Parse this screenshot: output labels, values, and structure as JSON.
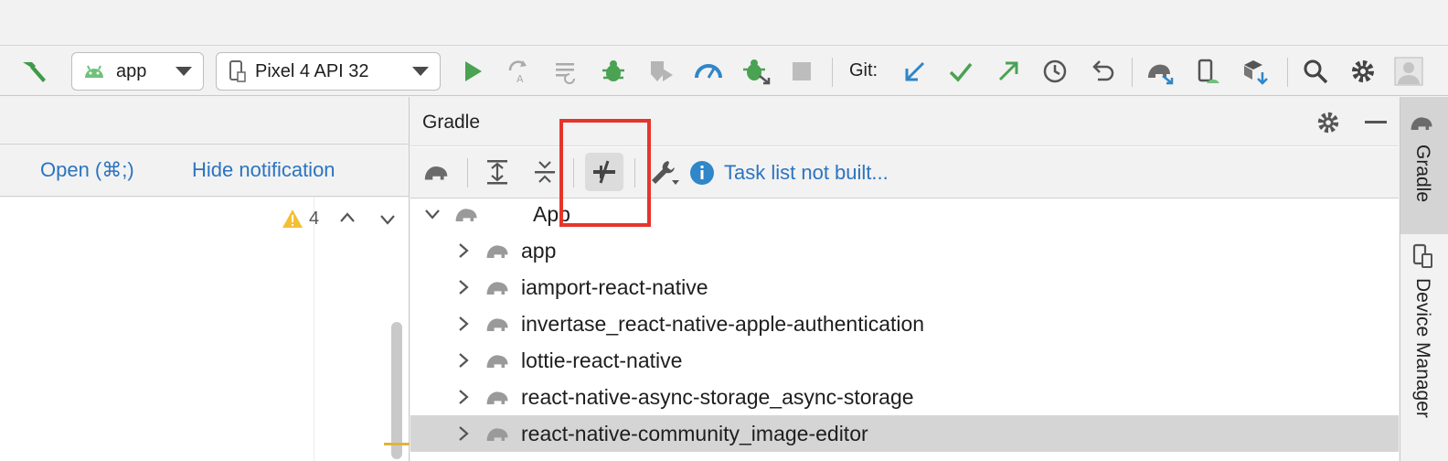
{
  "toolbar": {
    "run_config": "app",
    "device": "Pixel 4 API 32",
    "git_label": "Git:",
    "icons": [
      "hammer-icon",
      "android-icon",
      "device-icon",
      "run-icon",
      "apply-changes-icon",
      "apply-code-icon",
      "debug-icon",
      "attach-debugger-icon",
      "profile-icon",
      "attach-bug-icon",
      "stop-icon",
      "git-update-icon",
      "git-commit-icon",
      "git-push-icon",
      "history-icon",
      "rollback-icon",
      "gradle-sync-icon",
      "device-manager-icon",
      "sdk-manager-icon",
      "search-icon",
      "gear-icon",
      "avatar-icon"
    ]
  },
  "notification": {
    "open_link": "Open (⌘;)",
    "hide_link": "Hide notification"
  },
  "editor": {
    "warning_count": "4"
  },
  "gradle": {
    "title": "Gradle",
    "info_text": "Task list not built...",
    "tree": [
      {
        "label": "App",
        "expanded": true,
        "level": 0,
        "selected": false
      },
      {
        "label": "app",
        "expanded": false,
        "level": 1,
        "selected": false
      },
      {
        "label": "iamport-react-native",
        "expanded": false,
        "level": 1,
        "selected": false
      },
      {
        "label": "invertase_react-native-apple-authentication",
        "expanded": false,
        "level": 1,
        "selected": false
      },
      {
        "label": "lottie-react-native",
        "expanded": false,
        "level": 1,
        "selected": false
      },
      {
        "label": "react-native-async-storage_async-storage",
        "expanded": false,
        "level": 1,
        "selected": false
      },
      {
        "label": "react-native-community_image-editor",
        "expanded": false,
        "level": 1,
        "selected": true
      }
    ]
  },
  "stripe": {
    "gradle_tab": "Gradle",
    "device_manager_tab": "Device Manager"
  },
  "colors": {
    "accent_blue": "#2b74c0",
    "run_green": "#4aa253",
    "highlight_red": "#e5352b"
  }
}
